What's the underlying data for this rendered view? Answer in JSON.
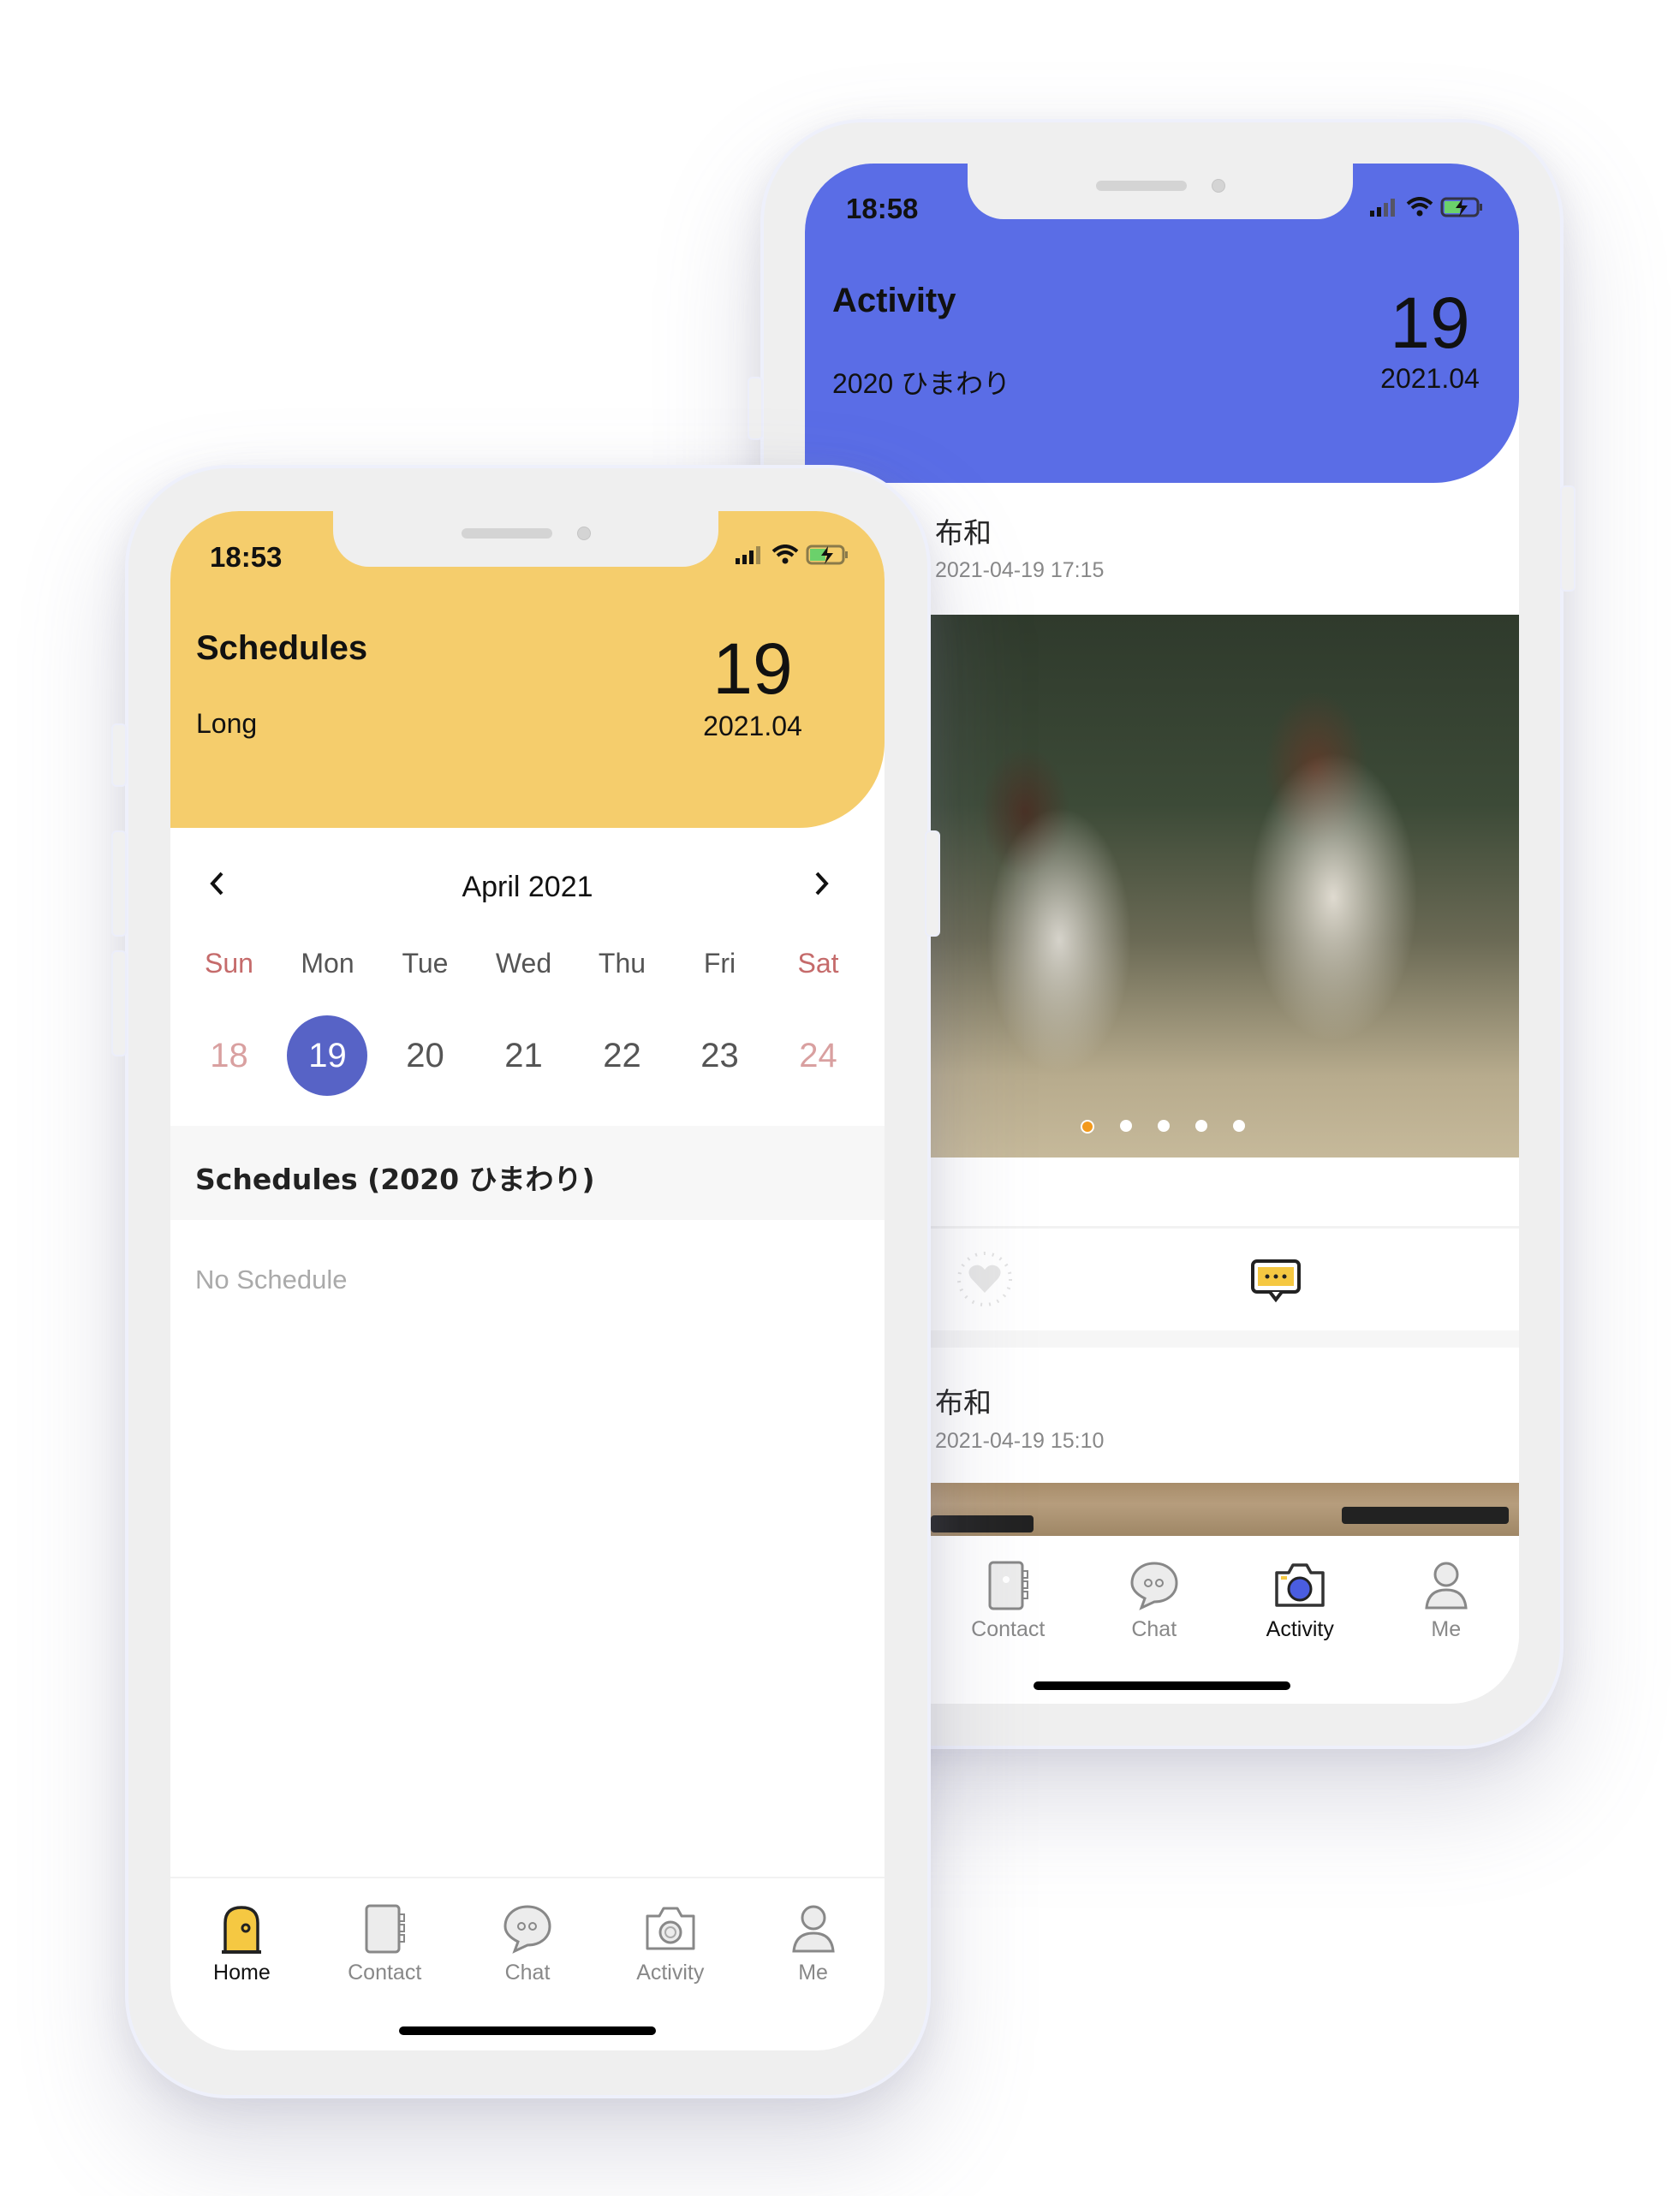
{
  "left_phone": {
    "status": {
      "time": "18:53"
    },
    "header": {
      "title": "Schedules",
      "subtitle": "Long",
      "day": "19",
      "year_month": "2021.04",
      "color": "#f5cd6c"
    },
    "calendar": {
      "month_label": "April 2021",
      "prev_icon": "chevron-left-icon",
      "next_icon": "chevron-right-icon",
      "weekdays": [
        "Sun",
        "Mon",
        "Tue",
        "Wed",
        "Thu",
        "Fri",
        "Sat"
      ],
      "days": [
        "18",
        "19",
        "20",
        "21",
        "22",
        "23",
        "24"
      ],
      "selected_day": "19",
      "selected_color": "#5763c6"
    },
    "schedules": {
      "section_title": "Schedules (2020 ひまわり)",
      "empty_text": "No Schedule"
    },
    "tabbar": {
      "items": [
        {
          "label": "Home",
          "icon": "home-door-icon",
          "active": true
        },
        {
          "label": "Contact",
          "icon": "contact-book-icon",
          "active": false
        },
        {
          "label": "Chat",
          "icon": "chat-bubble-icon",
          "active": false
        },
        {
          "label": "Activity",
          "icon": "camera-icon",
          "active": false
        },
        {
          "label": "Me",
          "icon": "person-icon",
          "active": false
        }
      ]
    }
  },
  "right_phone": {
    "status": {
      "time": "18:58"
    },
    "header": {
      "title": "Activity",
      "subtitle": "2020 ひまわり",
      "day": "19",
      "year_month": "2021.04",
      "color": "#5a6de6"
    },
    "posts": [
      {
        "author": "布和",
        "timestamp": "2021-04-19 17:15",
        "image": "girls-in-grass-photo",
        "carousel_pages": 5,
        "carousel_active": 1
      },
      {
        "author": "布和",
        "timestamp": "2021-04-19 15:10",
        "image": "playground-swings-photo"
      }
    ],
    "actions": {
      "like_icon": "heart-icon",
      "comment_icon": "comment-icon"
    },
    "tabbar": {
      "items": [
        {
          "label": "Contact",
          "icon": "contact-book-icon",
          "active": false
        },
        {
          "label": "Chat",
          "icon": "chat-bubble-icon",
          "active": false
        },
        {
          "label": "Activity",
          "icon": "camera-icon",
          "active": true
        },
        {
          "label": "Me",
          "icon": "person-icon",
          "active": false
        }
      ]
    }
  }
}
